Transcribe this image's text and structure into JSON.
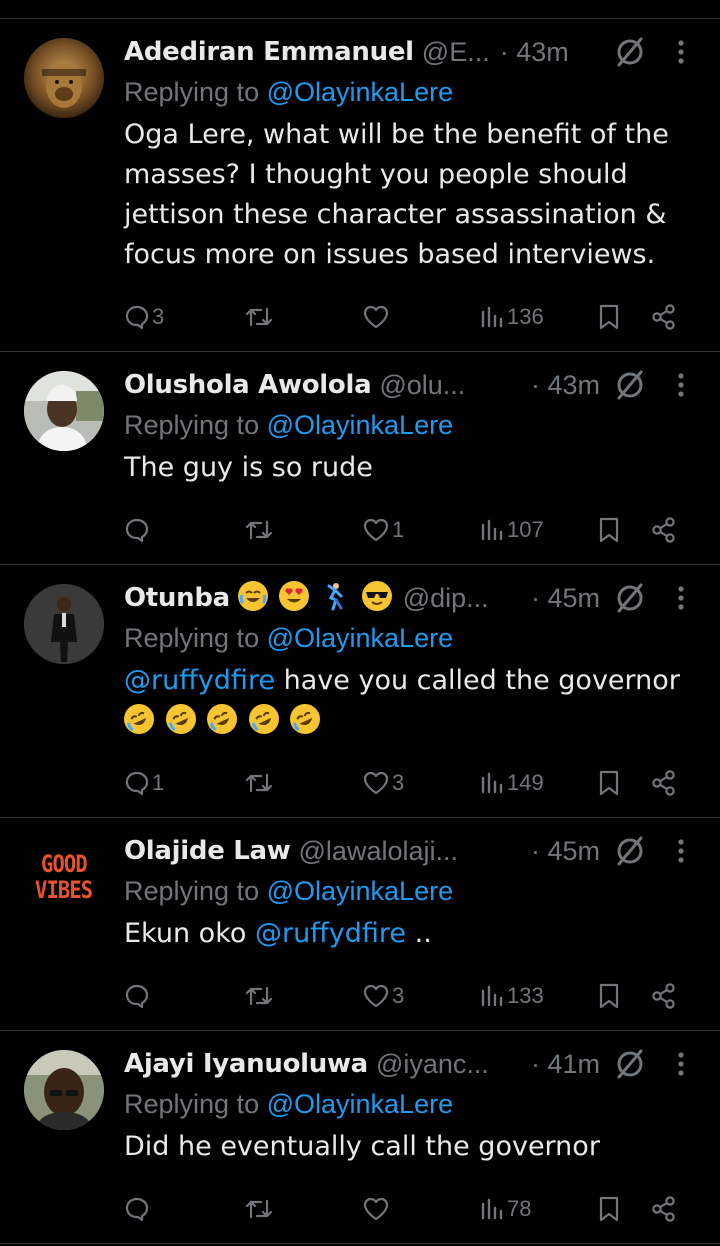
{
  "colors": {
    "background": "#000000",
    "divider": "#2f3336",
    "text_primary": "#e7e9ea",
    "text_secondary": "#71767b",
    "link": "#1d9bf0"
  },
  "icons": {
    "reply": "speech-bubble-icon",
    "retweet": "retweet-icon",
    "like": "heart-icon",
    "views": "bar-chart-icon",
    "bookmark": "bookmark-icon",
    "share": "share-icon",
    "grok": "grok-icon",
    "more": "vertical-dots-icon"
  },
  "replies": [
    {
      "name": "Adediran Emmanuel",
      "handle": "@E...",
      "time": "· 43m",
      "replying_prefix": "Replying to ",
      "replying_to": "@OlayinkaLere",
      "body": "Oga Lere, what will be the benefit of the masses? I thought you people should jettison these character assassination & focus more on issues based interviews.",
      "reply_count": "3",
      "retweet_count": "",
      "like_count": "",
      "view_count": "136",
      "avatar": "lion-avatar"
    },
    {
      "name": "Olushola Awolola",
      "handle": "@olu...",
      "time": "· 43m",
      "replying_prefix": "Replying to ",
      "replying_to": "@OlayinkaLere",
      "body": "The guy is so rude",
      "reply_count": "",
      "retweet_count": "",
      "like_count": "1",
      "view_count": "107",
      "avatar": "man-cap-avatar"
    },
    {
      "name": "Otunba",
      "name_emojis": [
        "face-with-tears-of-joy",
        "smiling-face-with-heart-eyes",
        "man-dancing",
        "smiling-face-with-sunglasses"
      ],
      "handle": "@dip...",
      "time": "· 45m",
      "replying_prefix": "Replying to ",
      "replying_to": "@OlayinkaLere",
      "body_mention": "@ruffydfire",
      "body": " have you called the governor",
      "body_emojis": [
        "rolling-on-floor-laughing",
        "rolling-on-floor-laughing",
        "rolling-on-floor-laughing",
        "rolling-on-floor-laughing",
        "rolling-on-floor-laughing"
      ],
      "reply_count": "1",
      "retweet_count": "",
      "like_count": "3",
      "view_count": "149",
      "avatar": "man-suit-avatar"
    },
    {
      "name": "Olajide Law",
      "handle": "@lawalolaji...",
      "time": "· 45m",
      "replying_prefix": "Replying to ",
      "replying_to": "@OlayinkaLere",
      "body_prefix": "Ekun oko ",
      "body_mention": "@ruffydfire",
      "body_suffix": " ..",
      "reply_count": "",
      "retweet_count": "",
      "like_count": "3",
      "view_count": "133",
      "avatar_text": [
        "GOOD",
        "VIBES"
      ]
    },
    {
      "name": "Ajayi Iyanuoluwa",
      "handle": "@iyanc...",
      "time": "· 41m",
      "replying_prefix": "Replying to ",
      "replying_to": "@OlayinkaLere",
      "body": "Did he eventually call the governor",
      "reply_count": "",
      "retweet_count": "",
      "like_count": "",
      "view_count": "78",
      "avatar": "man-selfie-avatar"
    }
  ]
}
